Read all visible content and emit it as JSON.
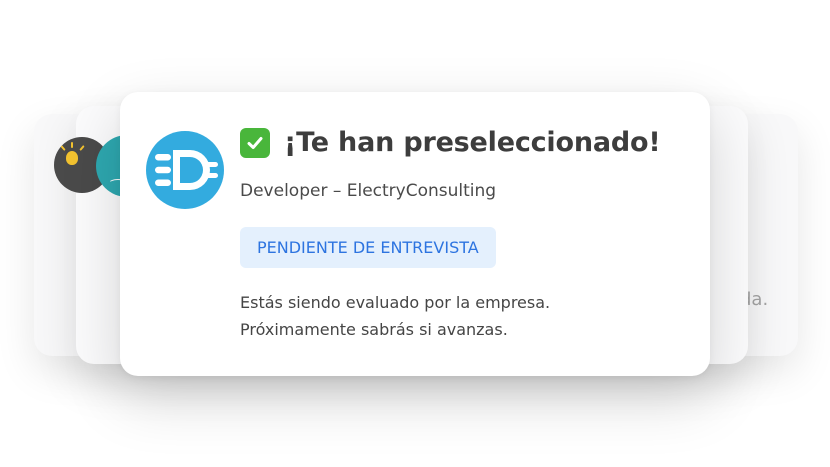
{
  "notification": {
    "title": "¡Te han preseleccionado!",
    "job": "Developer – ElectryConsulting",
    "status_badge": "PENDIENTE DE ENTREVISTA",
    "description_line1": "Estás siendo evaluado por la empresa.",
    "description_line2": "Próximamente sabrás si avanzas."
  },
  "background_card": {
    "visible_text": "da."
  },
  "icons": {
    "title_icon": "check-mark-icon",
    "company_logo": "electryconsulting-logo",
    "bg_avatar_1": "lightbulb-icon",
    "bg_avatar_2": "teal-company-logo"
  },
  "colors": {
    "brand_blue": "#33abdf",
    "badge_bg": "#e4f0fd",
    "badge_text": "#2d74e0",
    "check_green": "#49b63b",
    "title_text": "#3d3d3d"
  }
}
